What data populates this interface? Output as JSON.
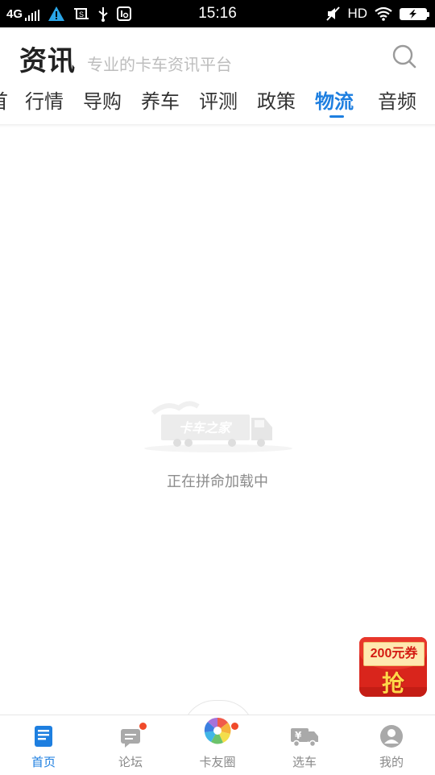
{
  "status_bar": {
    "network": "4G",
    "time": "15:16",
    "hd": "HD",
    "icons": [
      "signal-icon",
      "warning-icon",
      "screenshot-icon",
      "usb-icon",
      "usb-debug-icon",
      "mute-icon",
      "wifi-icon",
      "battery-charging-icon"
    ]
  },
  "header": {
    "title": "资讯",
    "subtitle": "专业的卡车资讯平台",
    "search_icon": "search-icon"
  },
  "tabs": [
    {
      "label": "行情",
      "active": false
    },
    {
      "label": "导购",
      "active": false
    },
    {
      "label": "养车",
      "active": false
    },
    {
      "label": "评测",
      "active": false
    },
    {
      "label": "政策",
      "active": false
    },
    {
      "label": "物流",
      "active": true
    },
    {
      "label": "音频",
      "active": false
    }
  ],
  "tab_partial": "首",
  "loading": {
    "text": "正在拼命加载中",
    "watermark": "卡车之家"
  },
  "coupon": {
    "label": "200元券",
    "action": "抢"
  },
  "bottom_nav": [
    {
      "label": "首页",
      "icon": "news-icon",
      "active": true,
      "badge": false
    },
    {
      "label": "论坛",
      "icon": "forum-icon",
      "active": false,
      "badge": true
    },
    {
      "label": "卡友圈",
      "icon": "pinwheel-icon",
      "active": false,
      "badge": true
    },
    {
      "label": "选车",
      "icon": "truck-price-icon",
      "active": false,
      "badge": false
    },
    {
      "label": "我的",
      "icon": "profile-icon",
      "active": false,
      "badge": false
    }
  ],
  "colors": {
    "accent": "#1e7fe0",
    "badge": "#f04a2a",
    "coupon_red": "#d9251c",
    "coupon_gold": "#ffd84a"
  }
}
